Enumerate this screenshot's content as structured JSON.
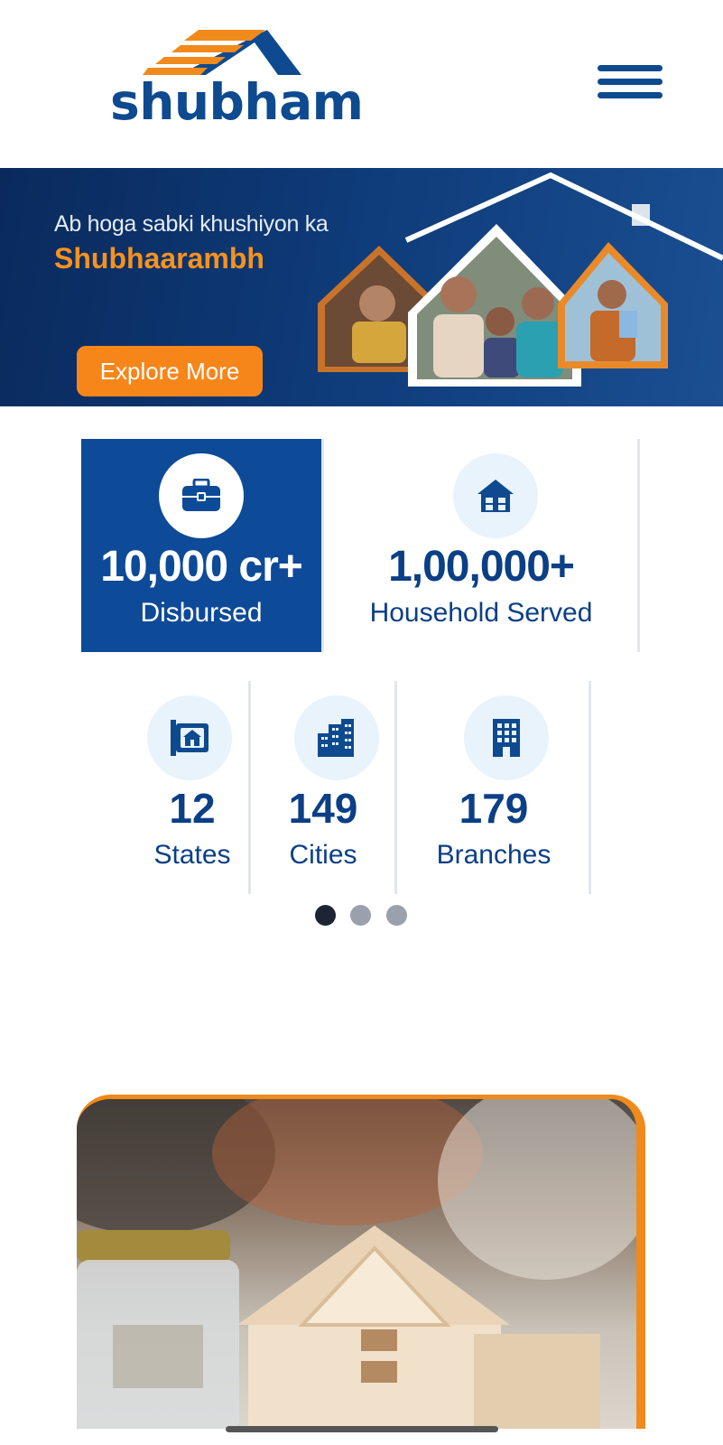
{
  "brand": {
    "name": "shubham",
    "primary_color": "#0d4a8f",
    "accent_color": "#f08a1c"
  },
  "header": {
    "menu_icon": "hamburger-menu-icon"
  },
  "banner": {
    "line1": "Ab hoga sabki khushiyon ka",
    "line2": "Shubhaarambh",
    "cta_label": "Explore More"
  },
  "stats_row1": [
    {
      "value": "10,000 cr+",
      "label": "Disbursed",
      "icon": "briefcase-icon"
    },
    {
      "value": "1,00,000+",
      "label": "Household Served",
      "icon": "house-icon"
    }
  ],
  "stats_row2": [
    {
      "value": "12",
      "label": "States",
      "icon": "map-house-icon"
    },
    {
      "value": "149",
      "label": "Cities",
      "icon": "city-buildings-icon"
    },
    {
      "value": "179",
      "label": "Branches",
      "icon": "office-building-icon"
    }
  ],
  "carousel": {
    "pages": 3,
    "active_index": 0
  }
}
